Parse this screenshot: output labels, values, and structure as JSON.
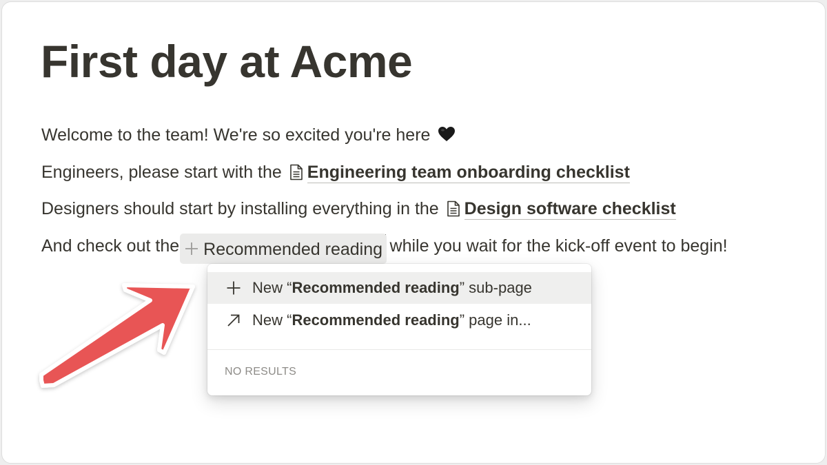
{
  "page": {
    "title": "First day at Acme"
  },
  "content": {
    "line1": {
      "text": "Welcome to the team! We're so excited you're here",
      "emoji": "black-heart-icon"
    },
    "line2": {
      "before": "Engineers, please start with the",
      "link_icon": "page-document-icon",
      "link_text": "Engineering team onboarding checklist"
    },
    "line3": {
      "before": "Designers should start by installing everything in the",
      "link_icon": "page-document-icon",
      "link_text": "Design software checklist"
    },
    "line4": {
      "before": "And check out the",
      "mention_icon": "plus-icon",
      "mention_text": "Recommended reading",
      "after": "while you wait for the kick-off event to begin!"
    }
  },
  "dropdown": {
    "items": [
      {
        "icon": "plus-icon",
        "prefix": "New “",
        "bold": "Recommended reading",
        "suffix": "” sub-page",
        "selected": true
      },
      {
        "icon": "arrow-up-right-icon",
        "prefix": "New “",
        "bold": "Recommended reading",
        "suffix": "” page in...",
        "selected": false
      }
    ],
    "empty_label": "NO RESULTS"
  },
  "colors": {
    "text": "#37352f",
    "annotation_arrow": "#e85555",
    "mention_bg": "#ebebea",
    "selected_bg": "#efefee"
  }
}
